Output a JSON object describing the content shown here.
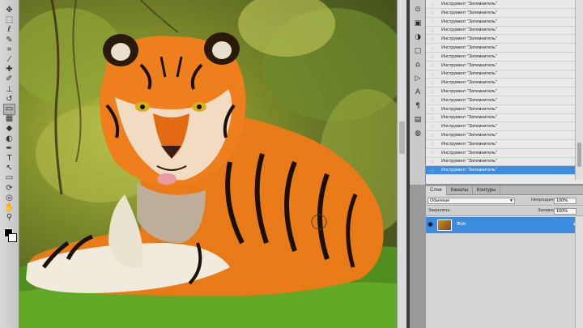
{
  "toolbar": {
    "tools": [
      {
        "name": "move-tool-icon",
        "glyph": "✥"
      },
      {
        "name": "marquee-tool-icon",
        "glyph": "⬚"
      },
      {
        "name": "lasso-tool-icon",
        "glyph": "ℓ"
      },
      {
        "name": "quick-select-tool-icon",
        "glyph": "✎"
      },
      {
        "name": "crop-tool-icon",
        "glyph": "⌗"
      },
      {
        "name": "eyedropper-tool-icon",
        "glyph": "⁄"
      },
      {
        "name": "healing-brush-tool-icon",
        "glyph": "✚"
      },
      {
        "name": "brush-tool-icon",
        "glyph": "✐"
      },
      {
        "name": "clone-stamp-tool-icon",
        "glyph": "⊥"
      },
      {
        "name": "history-brush-tool-icon",
        "glyph": "↺"
      },
      {
        "name": "eraser-tool-icon",
        "glyph": "▭"
      },
      {
        "name": "gradient-tool-icon",
        "glyph": "▦"
      },
      {
        "name": "blur-tool-icon",
        "glyph": "◆"
      },
      {
        "name": "dodge-tool-icon",
        "glyph": "◐"
      },
      {
        "name": "pen-tool-icon",
        "glyph": "✒"
      },
      {
        "name": "type-tool-icon",
        "glyph": "T"
      },
      {
        "name": "path-select-tool-icon",
        "glyph": "↖"
      },
      {
        "name": "shape-tool-icon",
        "glyph": "▭"
      },
      {
        "name": "3d-rotate-tool-icon",
        "glyph": "⟳"
      },
      {
        "name": "3d-orbit-tool-icon",
        "glyph": "◎"
      },
      {
        "name": "hand-tool-icon",
        "glyph": "✋"
      },
      {
        "name": "zoom-tool-icon",
        "glyph": "⚲"
      }
    ],
    "active_index": 10,
    "foreground_color": "#000000",
    "background_color": "#ffffff"
  },
  "panel_icons": [
    {
      "name": "history-panel-icon",
      "glyph": "⊙"
    },
    {
      "name": "swatches-panel-icon",
      "glyph": "▣"
    },
    {
      "name": "adjustments-panel-icon",
      "glyph": "◑"
    },
    {
      "name": "masks-panel-icon",
      "glyph": "▢"
    },
    {
      "name": "styles-panel-icon",
      "glyph": "⌂"
    },
    {
      "name": "actions-panel-icon",
      "glyph": "▷"
    },
    {
      "name": "character-panel-icon",
      "glyph": "A"
    },
    {
      "name": "paragraph-panel-icon",
      "glyph": "¶"
    },
    {
      "name": "clone-source-panel-icon",
      "glyph": "▤"
    },
    {
      "name": "brushes-panel-icon",
      "glyph": "◍"
    }
  ],
  "history": {
    "items": [
      "Инструмент \"Затемнитель\"",
      "Инструмент \"Затемнитель\"",
      "Инструмент \"Затемнитель\"",
      "Инструмент \"Затемнитель\"",
      "Инструмент \"Затемнитель\"",
      "Инструмент \"Затемнитель\"",
      "Инструмент \"Затемнитель\"",
      "Инструмент \"Затемнитель\"",
      "Инструмент \"Затемнитель\"",
      "Инструмент \"Затемнитель\"",
      "Инструмент \"Затемнитель\"",
      "Инструмент \"Затемнитель\"",
      "Инструмент \"Затемнитель\"",
      "Инструмент \"Затемнитель\"",
      "Инструмент \"Затемнитель\"",
      "Инструмент \"Затемнитель\"",
      "Инструмент \"Затемнитель\"",
      "Инструмент \"Затемнитель\"",
      "Инструмент \"Затемнитель\"",
      "Инструмент \"Затемнитель\""
    ],
    "active_index": 19,
    "highlight_color": "#3c8ce0"
  },
  "layers": {
    "tabs": [
      "Слои",
      "Каналы",
      "Контуры"
    ],
    "active_tab": 0,
    "blend_mode": "Обычные",
    "opacity_label": "Непрозрачность:",
    "opacity_value": "100%",
    "lock_label": "Закрепить:",
    "fill_label": "Заливка:",
    "fill_value": "100%",
    "items": [
      {
        "name": "Фон",
        "visible": true,
        "locked": true,
        "selected": true
      }
    ]
  }
}
